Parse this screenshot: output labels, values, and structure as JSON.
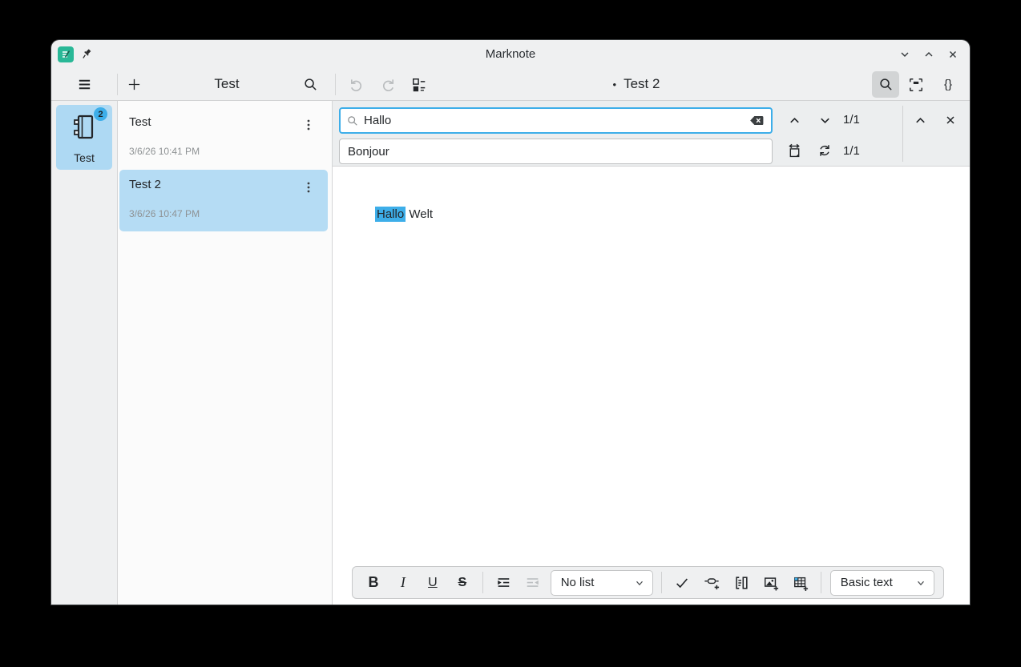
{
  "titlebar": {
    "title": "Marknote"
  },
  "toolbar": {
    "notebook_title": "Test",
    "note_modified_dot": "•",
    "note_title": "Test 2",
    "braces_label": "{}"
  },
  "sidebar": {
    "notebook_label": "Test",
    "notebook_badge": "2"
  },
  "note_list": {
    "items": [
      {
        "title": "Test",
        "date": "3/6/26 10:41 PM"
      },
      {
        "title": "Test 2",
        "date": "3/6/26 10:47 PM"
      }
    ]
  },
  "search_panel": {
    "query": "Hallo",
    "replace_value": "Bonjour",
    "match_position": "1/1",
    "replace_position": "1/1"
  },
  "editor": {
    "highlighted_text": "Hallo",
    "following_text": "Welt"
  },
  "format_bar": {
    "bold_label": "B",
    "italic_label": "I",
    "underline_label": "U",
    "strikethrough_label": "S",
    "list_style_value": "No list",
    "text_style_value": "Basic text"
  },
  "colors": {
    "accent": "#3daee9",
    "selection_bg": "#b5dcf4",
    "window_bg": "#eff0f1"
  }
}
